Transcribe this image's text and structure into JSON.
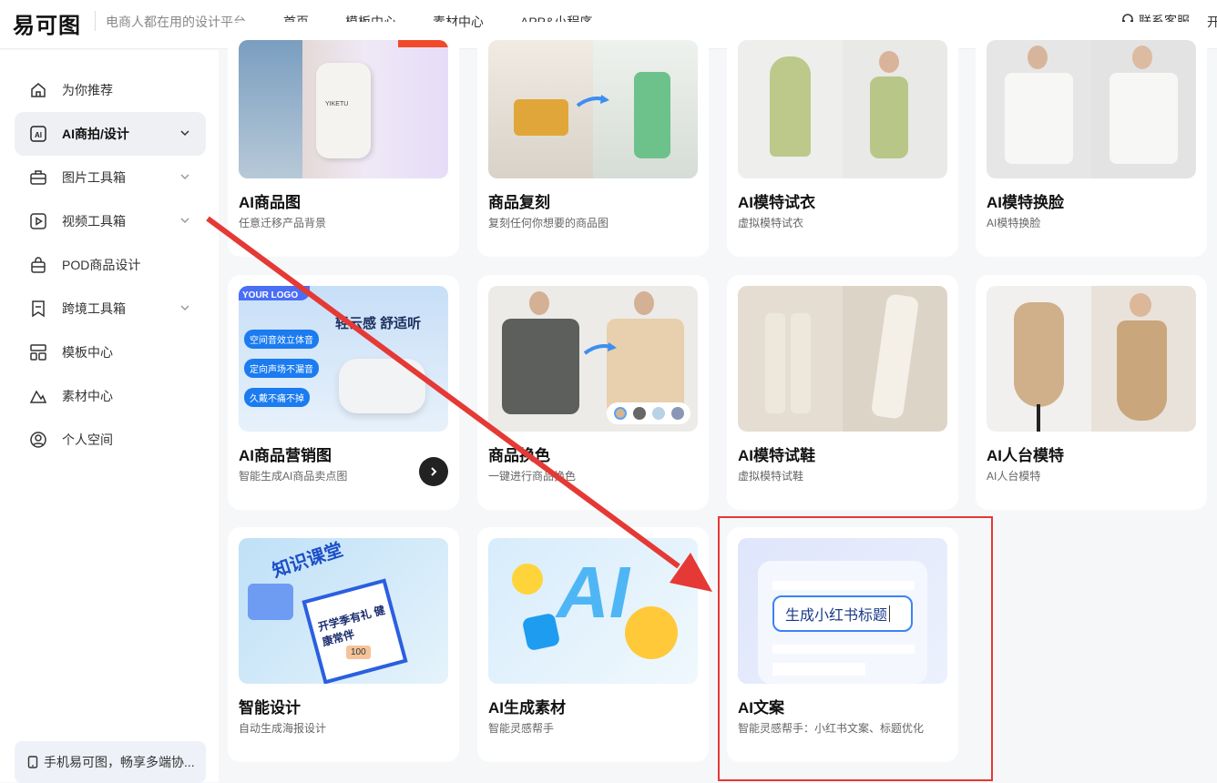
{
  "header": {
    "logo": "易可图",
    "slogan": "电商人都在用的设计平台",
    "nav": [
      "首页",
      "模板中心",
      "素材中心",
      "APP&小程序"
    ],
    "support": "联系客服",
    "cut_text": "开"
  },
  "sidebar": {
    "items": [
      {
        "label": "为你推荐",
        "icon": "home-icon",
        "chevron": false,
        "active": false
      },
      {
        "label": "AI商拍/设计",
        "icon": "ai-icon",
        "chevron": true,
        "active": true
      },
      {
        "label": "图片工具箱",
        "icon": "toolbox-icon",
        "chevron": true,
        "active": false
      },
      {
        "label": "视频工具箱",
        "icon": "video-icon",
        "chevron": true,
        "active": false
      },
      {
        "label": "POD商品设计",
        "icon": "bag-icon",
        "chevron": false,
        "active": false
      },
      {
        "label": "跨境工具箱",
        "icon": "bookmark-icon",
        "chevron": true,
        "active": false
      },
      {
        "label": "模板中心",
        "icon": "template-icon",
        "chevron": false,
        "active": false
      },
      {
        "label": "素材中心",
        "icon": "material-icon",
        "chevron": false,
        "active": false
      },
      {
        "label": "个人空间",
        "icon": "user-icon",
        "chevron": false,
        "active": false
      }
    ],
    "promo": "手机易可图，畅享多端协..."
  },
  "cards": [
    {
      "title": "AI商品图",
      "desc": "任意迁移产品背景"
    },
    {
      "title": "商品复刻",
      "desc": "复刻任何你想要的商品图"
    },
    {
      "title": "AI模特试衣",
      "desc": "虚拟模特试衣"
    },
    {
      "title": "AI模特换脸",
      "desc": "AI模特换脸"
    },
    {
      "title": "AI商品营销图",
      "desc": "智能生成AI商品卖点图"
    },
    {
      "title": "商品换色",
      "desc": "一键进行商品换色"
    },
    {
      "title": "AI模特试鞋",
      "desc": "虚拟模特试鞋"
    },
    {
      "title": "AI人台模特",
      "desc": "AI人台模特"
    },
    {
      "title": "智能设计",
      "desc": "自动生成海报设计"
    },
    {
      "title": "AI生成素材",
      "desc": "智能灵感帮手"
    },
    {
      "title": "AI文案",
      "desc": "智能灵感帮手：小红书文案、标题优化"
    }
  ],
  "thumb_text": {
    "bottle_brand": "YIKETU",
    "marketing_logo": "YOUR LOGO",
    "marketing_headline": "轻云感 舒适听",
    "marketing_tags": [
      "空间音效立体音",
      "定向声场不漏音",
      "久戴不痛不掉"
    ],
    "design_title": "知识课堂",
    "design_sub": "开学季有礼 健康常伴",
    "design_price": "100",
    "ai_letters": "AI",
    "copy_input": "生成小红书标题"
  },
  "colors": {
    "accent_red": "#e53935",
    "active_bg": "#eef0f4",
    "text_blue": "#1a73e8"
  }
}
